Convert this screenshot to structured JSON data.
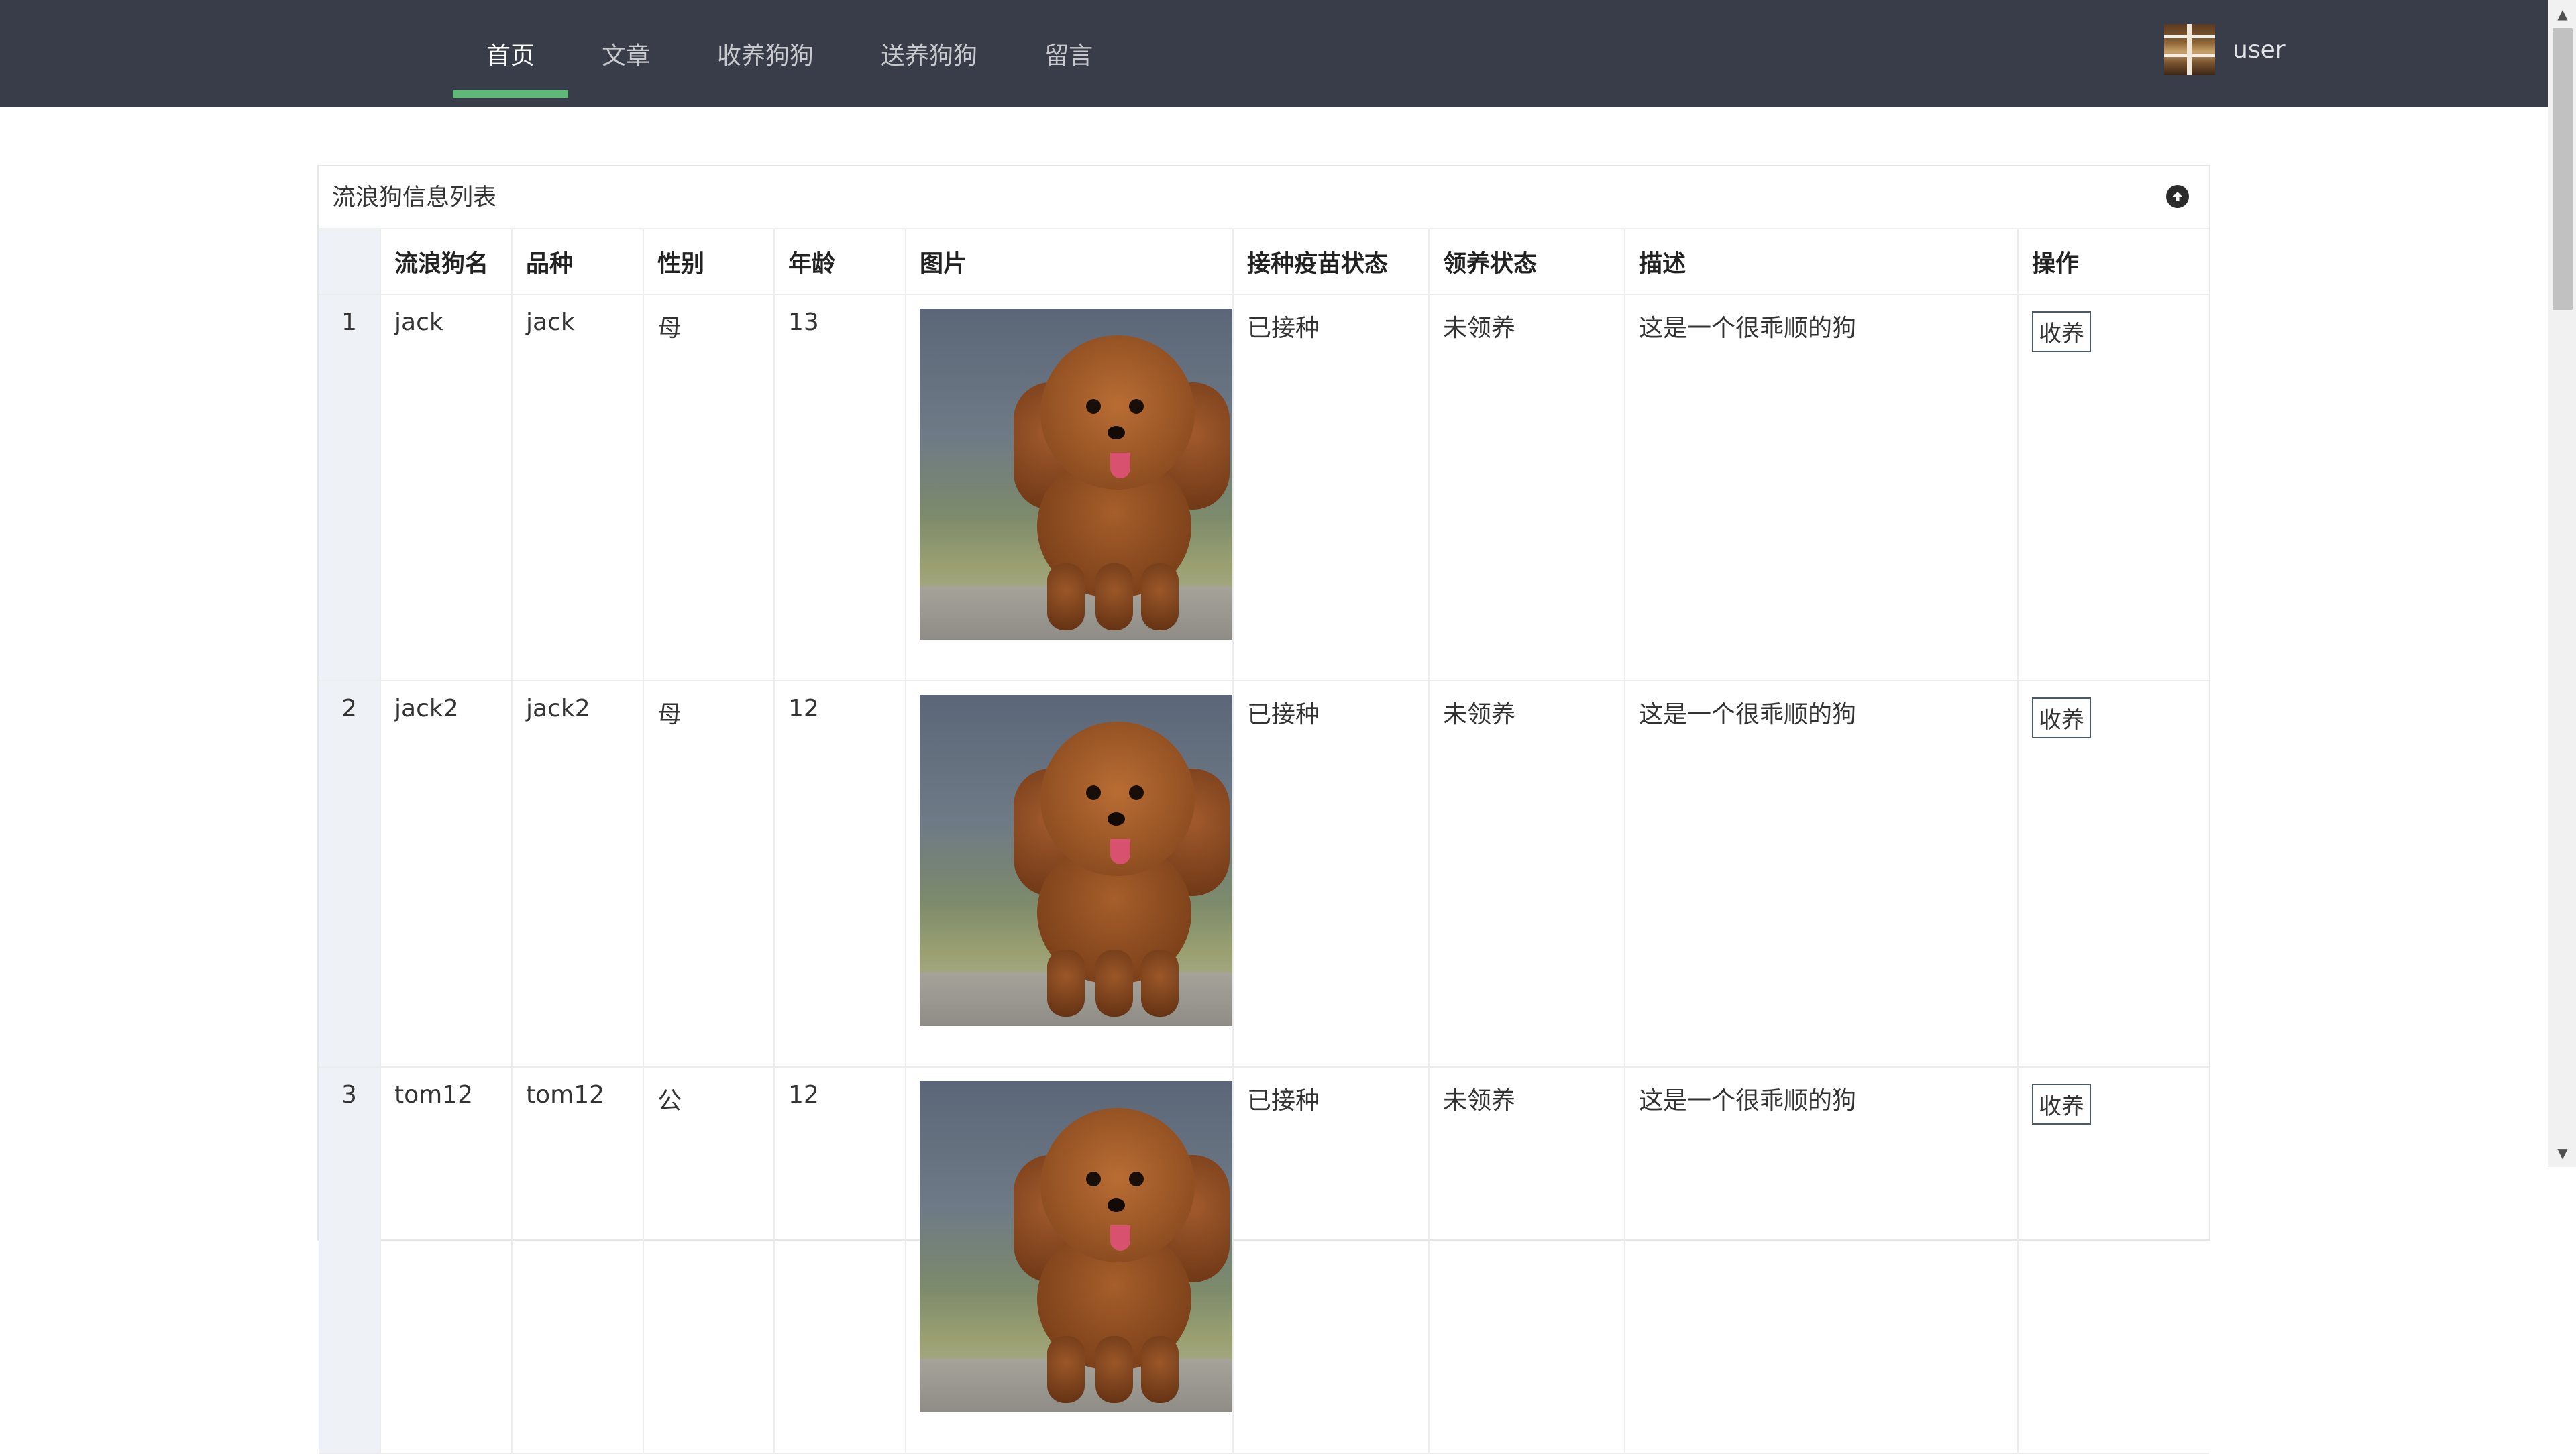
{
  "nav": {
    "items": [
      {
        "label": "首页",
        "active": true
      },
      {
        "label": "文章",
        "active": false
      },
      {
        "label": "收养狗狗",
        "active": false
      },
      {
        "label": "送养狗狗",
        "active": false
      },
      {
        "label": "留言",
        "active": false
      }
    ],
    "user_name": "user",
    "active_color": "#5fb878",
    "header_bg": "#393d49"
  },
  "card": {
    "title": "流浪狗信息列表",
    "collapse_icon": "arrow-up-circle-icon"
  },
  "table": {
    "headers": {
      "num": "",
      "name": "流浪狗名",
      "breed": "品种",
      "gender": "性别",
      "age": "年龄",
      "image": "图片",
      "vaccine": "接种疫苗状态",
      "adopt_status": "领养状态",
      "desc": "描述",
      "action": "操作"
    },
    "rows": [
      {
        "num": "1",
        "name": "jack",
        "breed": "jack",
        "gender": "母",
        "age": "13",
        "vaccine": "已接种",
        "adopt_status": "未领养",
        "desc": "这是一个很乖顺的狗",
        "action": "收养"
      },
      {
        "num": "2",
        "name": "jack2",
        "breed": "jack2",
        "gender": "母",
        "age": "12",
        "vaccine": "已接种",
        "adopt_status": "未领养",
        "desc": "这是一个很乖顺的狗",
        "action": "收养"
      },
      {
        "num": "3",
        "name": "tom12",
        "breed": "tom12",
        "gender": "公",
        "age": "12",
        "vaccine": "已接种",
        "adopt_status": "未领养",
        "desc": "这是一个很乖顺的狗",
        "action": "收养"
      }
    ]
  }
}
